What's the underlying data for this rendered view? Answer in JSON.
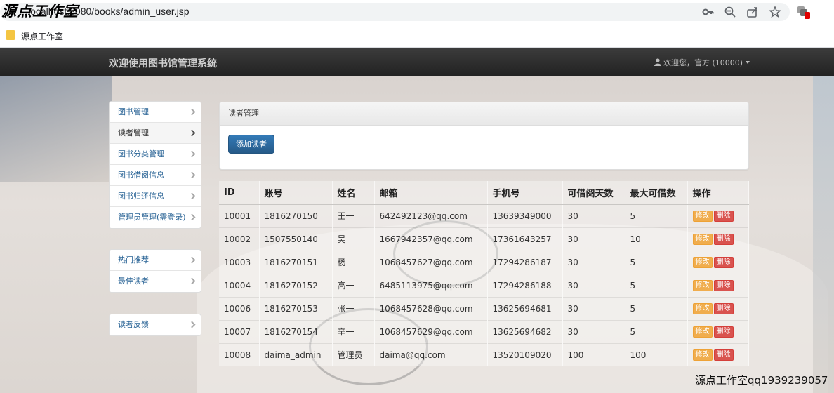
{
  "browser": {
    "url": "localhost:8080/books/admin_user.jsp",
    "watermark_top": "源点工作室",
    "bookmark": "源点工作室"
  },
  "navbar": {
    "brand": "欢迎使用图书馆管理系统",
    "user": "欢迎您，官方 (10000)"
  },
  "sidebar": {
    "group1": [
      "图书管理",
      "读者管理",
      "图书分类管理",
      "图书借阅信息",
      "图书归还信息",
      "管理员管理(需登录)"
    ],
    "group2": [
      "热门推荐",
      "最佳读者"
    ],
    "group3": [
      "读者反馈"
    ],
    "active_index": 1
  },
  "panel": {
    "title": "读者管理",
    "add_button": "添加读者"
  },
  "table": {
    "headers": [
      "ID",
      "账号",
      "姓名",
      "邮箱",
      "手机号",
      "可借阅天数",
      "最大可借数",
      "操作"
    ],
    "rows": [
      [
        "10001",
        "1816270150",
        "王一",
        "642492123@qq.com",
        "13639349000",
        "30",
        "5"
      ],
      [
        "10002",
        "1507550140",
        "吴一",
        "1667942357@qq.com",
        "17361643257",
        "30",
        "10"
      ],
      [
        "10003",
        "1816270151",
        "杨一",
        "1068457627@qq.com",
        "17294286187",
        "30",
        "5"
      ],
      [
        "10004",
        "1816270152",
        "高一",
        "6485113975@qq.com",
        "17294286188",
        "30",
        "5"
      ],
      [
        "10006",
        "1816270153",
        "张一",
        "1068457628@qq.com",
        "13625694681",
        "30",
        "5"
      ],
      [
        "10007",
        "1816270154",
        "辛一",
        "1068457629@qq.com",
        "13625694682",
        "30",
        "5"
      ],
      [
        "10008",
        "daima_admin",
        "管理员",
        "daima@qq.com",
        "13520109020",
        "100",
        "100"
      ]
    ],
    "edit_label": "修改",
    "delete_label": "删除"
  },
  "watermark_bottom": "源点工作室qq1939239057",
  "colors": {
    "navbar": "#2a2a2a",
    "primary": "#337ab7",
    "warning": "#f0ad4e",
    "danger": "#d9534f",
    "link": "#2a6496"
  }
}
